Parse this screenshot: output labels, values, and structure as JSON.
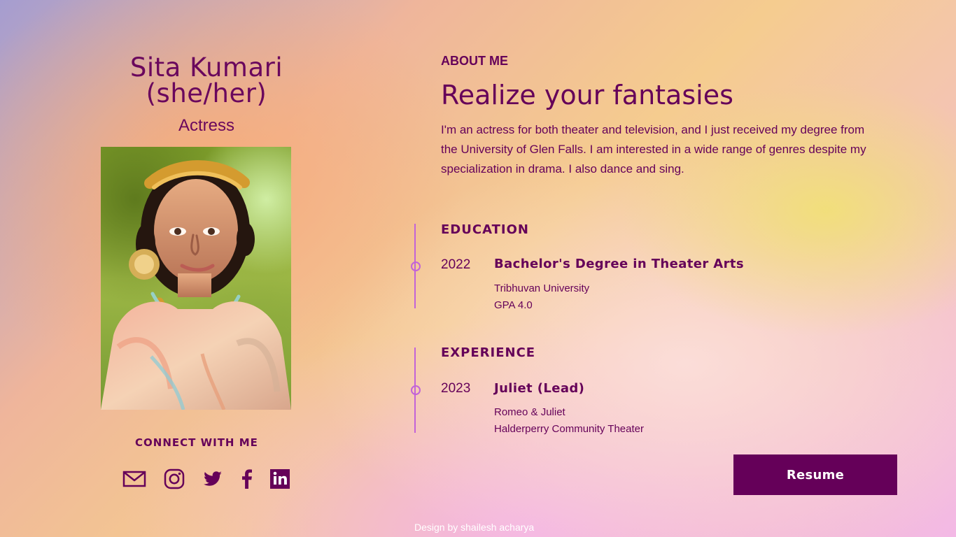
{
  "profile": {
    "name_line1": "Sita Kumari",
    "name_line2": "(she/her)",
    "role": "Actress"
  },
  "about": {
    "label": "ABOUT ME",
    "headline": "Realize your fantasies",
    "description": "I'm an actress for both theater and television, and I just received my degree from the University of Glen Falls. I am interested in a wide range of genres despite my specialization in drama. I also dance and sing."
  },
  "education": {
    "title": "EDUCATION",
    "entries": [
      {
        "year": "2022",
        "title": "Bachelor's Degree in Theater Arts",
        "line1": "Tribhuvan University",
        "line2": "GPA 4.0"
      }
    ]
  },
  "experience": {
    "title": "EXPERIENCE",
    "entries": [
      {
        "year": "2023",
        "title": "Juliet (Lead)",
        "line1": "Romeo & Juliet",
        "line2": "Halderperry Community Theater"
      }
    ]
  },
  "connect": {
    "title": "CONNECT WITH ME",
    "icons": [
      "mail-icon",
      "instagram-icon",
      "twitter-icon",
      "facebook-icon",
      "linkedin-icon"
    ]
  },
  "actions": {
    "resume_label": "Resume"
  },
  "footer": {
    "credit": "Design by shailesh acharya"
  },
  "colors": {
    "accent": "#650159",
    "timeline": "#c263d8",
    "button_bg": "#650059",
    "button_text": "#ffffff"
  }
}
